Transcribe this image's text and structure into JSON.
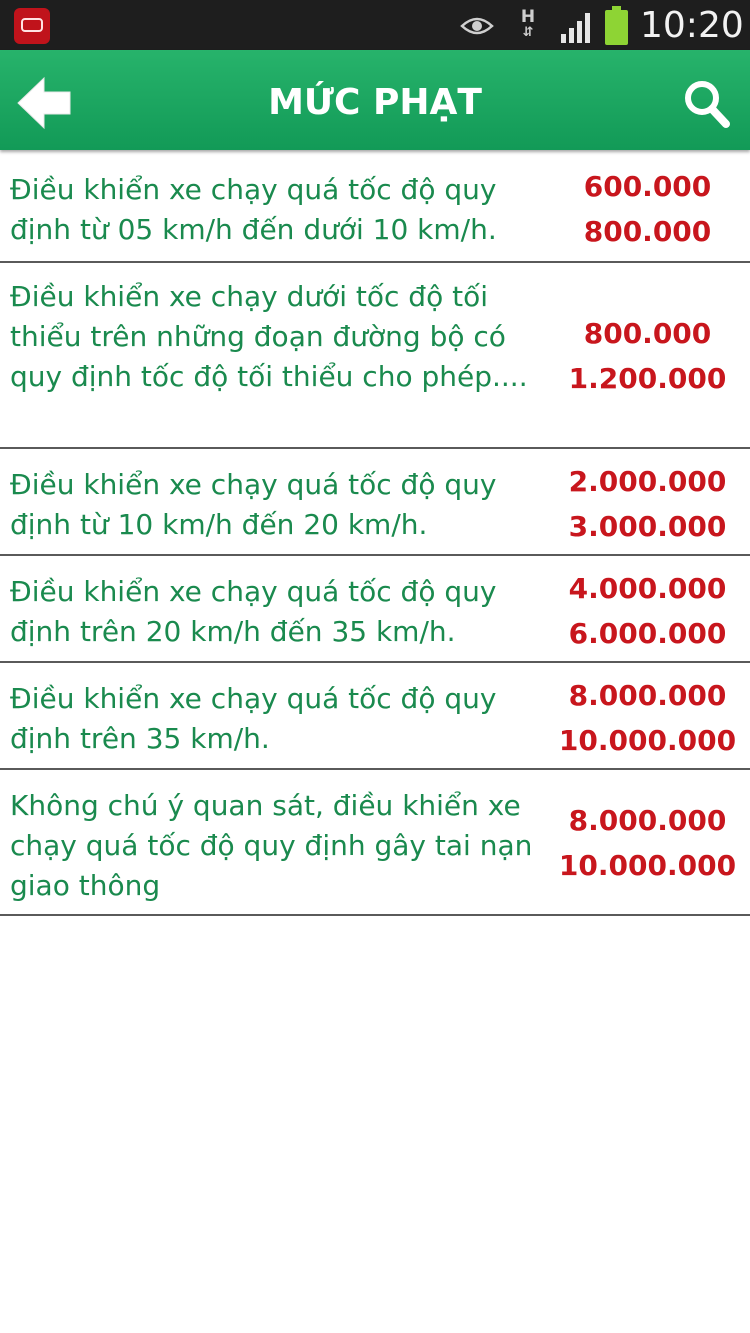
{
  "status_bar": {
    "time": "10:20",
    "h_label": "H",
    "h_arrows": "⇵",
    "icons": [
      "app-notification-icon",
      "eye-icon",
      "h-data-icon",
      "signal-icon",
      "battery-icon"
    ]
  },
  "header": {
    "title": "MỨC PHẠT",
    "back_icon": "arrow-left-icon",
    "search_icon": "search-icon",
    "color": "#1ba460"
  },
  "colors": {
    "description_text": "#1a8a4e",
    "amount_text": "#c8161d",
    "divider": "#5a5a5a"
  },
  "fines": [
    {
      "description": "Điều khiển xe chạy quá tốc độ quy định từ 05 km/h đến dưới 10 km/h.",
      "min_amount": "600.000",
      "max_amount": "800.000"
    },
    {
      "description": "Điều khiển xe chạy dưới tốc độ tối thiểu trên những đoạn đường bộ có quy định tốc độ tối thiểu cho phép....",
      "min_amount": "800.000",
      "max_amount": "1.200.000"
    },
    {
      "description": "Điều khiển xe chạy quá tốc độ quy định từ 10 km/h đến 20 km/h.",
      "min_amount": "2.000.000",
      "max_amount": "3.000.000"
    },
    {
      "description": "Điều khiển xe chạy quá tốc độ quy định trên 20 km/h đến 35 km/h.",
      "min_amount": "4.000.000",
      "max_amount": "6.000.000"
    },
    {
      "description": "Điều khiển xe chạy quá tốc độ quy định trên 35 km/h.",
      "min_amount": "8.000.000",
      "max_amount": "10.000.000"
    },
    {
      "description": "Không chú ý quan sát, điều khiển xe chạy quá tốc độ quy định gây tai nạn giao thông",
      "min_amount": "8.000.000",
      "max_amount": "10.000.000"
    }
  ]
}
